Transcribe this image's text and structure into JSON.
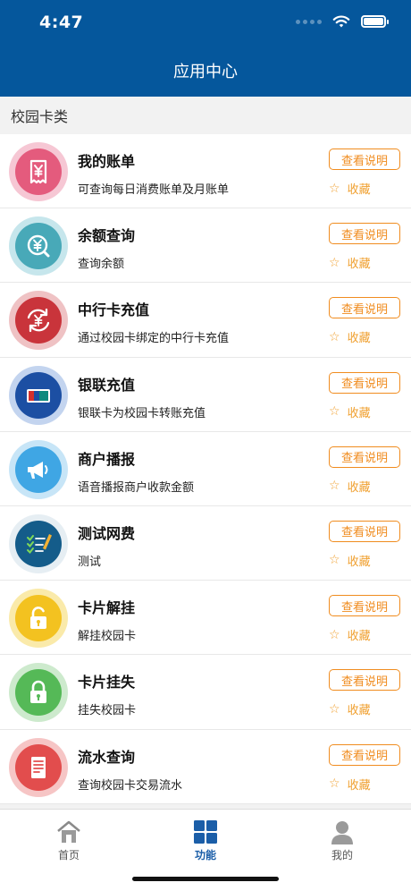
{
  "status_bar": {
    "time": "4:47"
  },
  "nav": {
    "title": "应用中心"
  },
  "section": {
    "title": "校园卡类"
  },
  "common": {
    "help_label": "查看说明",
    "fav_label": "收藏"
  },
  "items": [
    {
      "title": "我的账单",
      "desc": "可查询每日消费账单及月账单",
      "icon": "receipt-yen-icon",
      "color": "#e45b7d",
      "ring": "#f6c7d4"
    },
    {
      "title": "余额查询",
      "desc": "查询余额",
      "icon": "yen-search-icon",
      "color": "#48a9b8",
      "ring": "#c6e6ec"
    },
    {
      "title": "中行卡充值",
      "desc": "通过校园卡绑定的中行卡充值",
      "icon": "yen-exchange-icon",
      "color": "#c9343b",
      "ring": "#efc2c4"
    },
    {
      "title": "银联充值",
      "desc": "银联卡为校园卡转账充值",
      "icon": "unionpay-card-icon",
      "color": "#1c4fa3",
      "ring": "#c3d4ef"
    },
    {
      "title": "商户播报",
      "desc": "语音播报商户收款金额",
      "icon": "megaphone-icon",
      "color": "#3fa6e4",
      "ring": "#c7e5f7"
    },
    {
      "title": "测试网费",
      "desc": "测试",
      "icon": "checklist-pencil-icon",
      "color": "#145c8a",
      "ring": "#e6eef3"
    },
    {
      "title": "卡片解挂",
      "desc": "解挂校园卡",
      "icon": "unlock-icon",
      "color": "#f3c220",
      "ring": "#faeaaa"
    },
    {
      "title": "卡片挂失",
      "desc": "挂失校园卡",
      "icon": "lock-icon",
      "color": "#55b957",
      "ring": "#cdeacd"
    },
    {
      "title": "流水查询",
      "desc": "查询校园卡交易流水",
      "icon": "document-list-icon",
      "color": "#e24d4d",
      "ring": "#f6c5c5"
    }
  ],
  "tabs": [
    {
      "label": "首页",
      "icon": "home-icon"
    },
    {
      "label": "功能",
      "icon": "grid-icon",
      "active": true
    },
    {
      "label": "我的",
      "icon": "user-icon"
    }
  ]
}
